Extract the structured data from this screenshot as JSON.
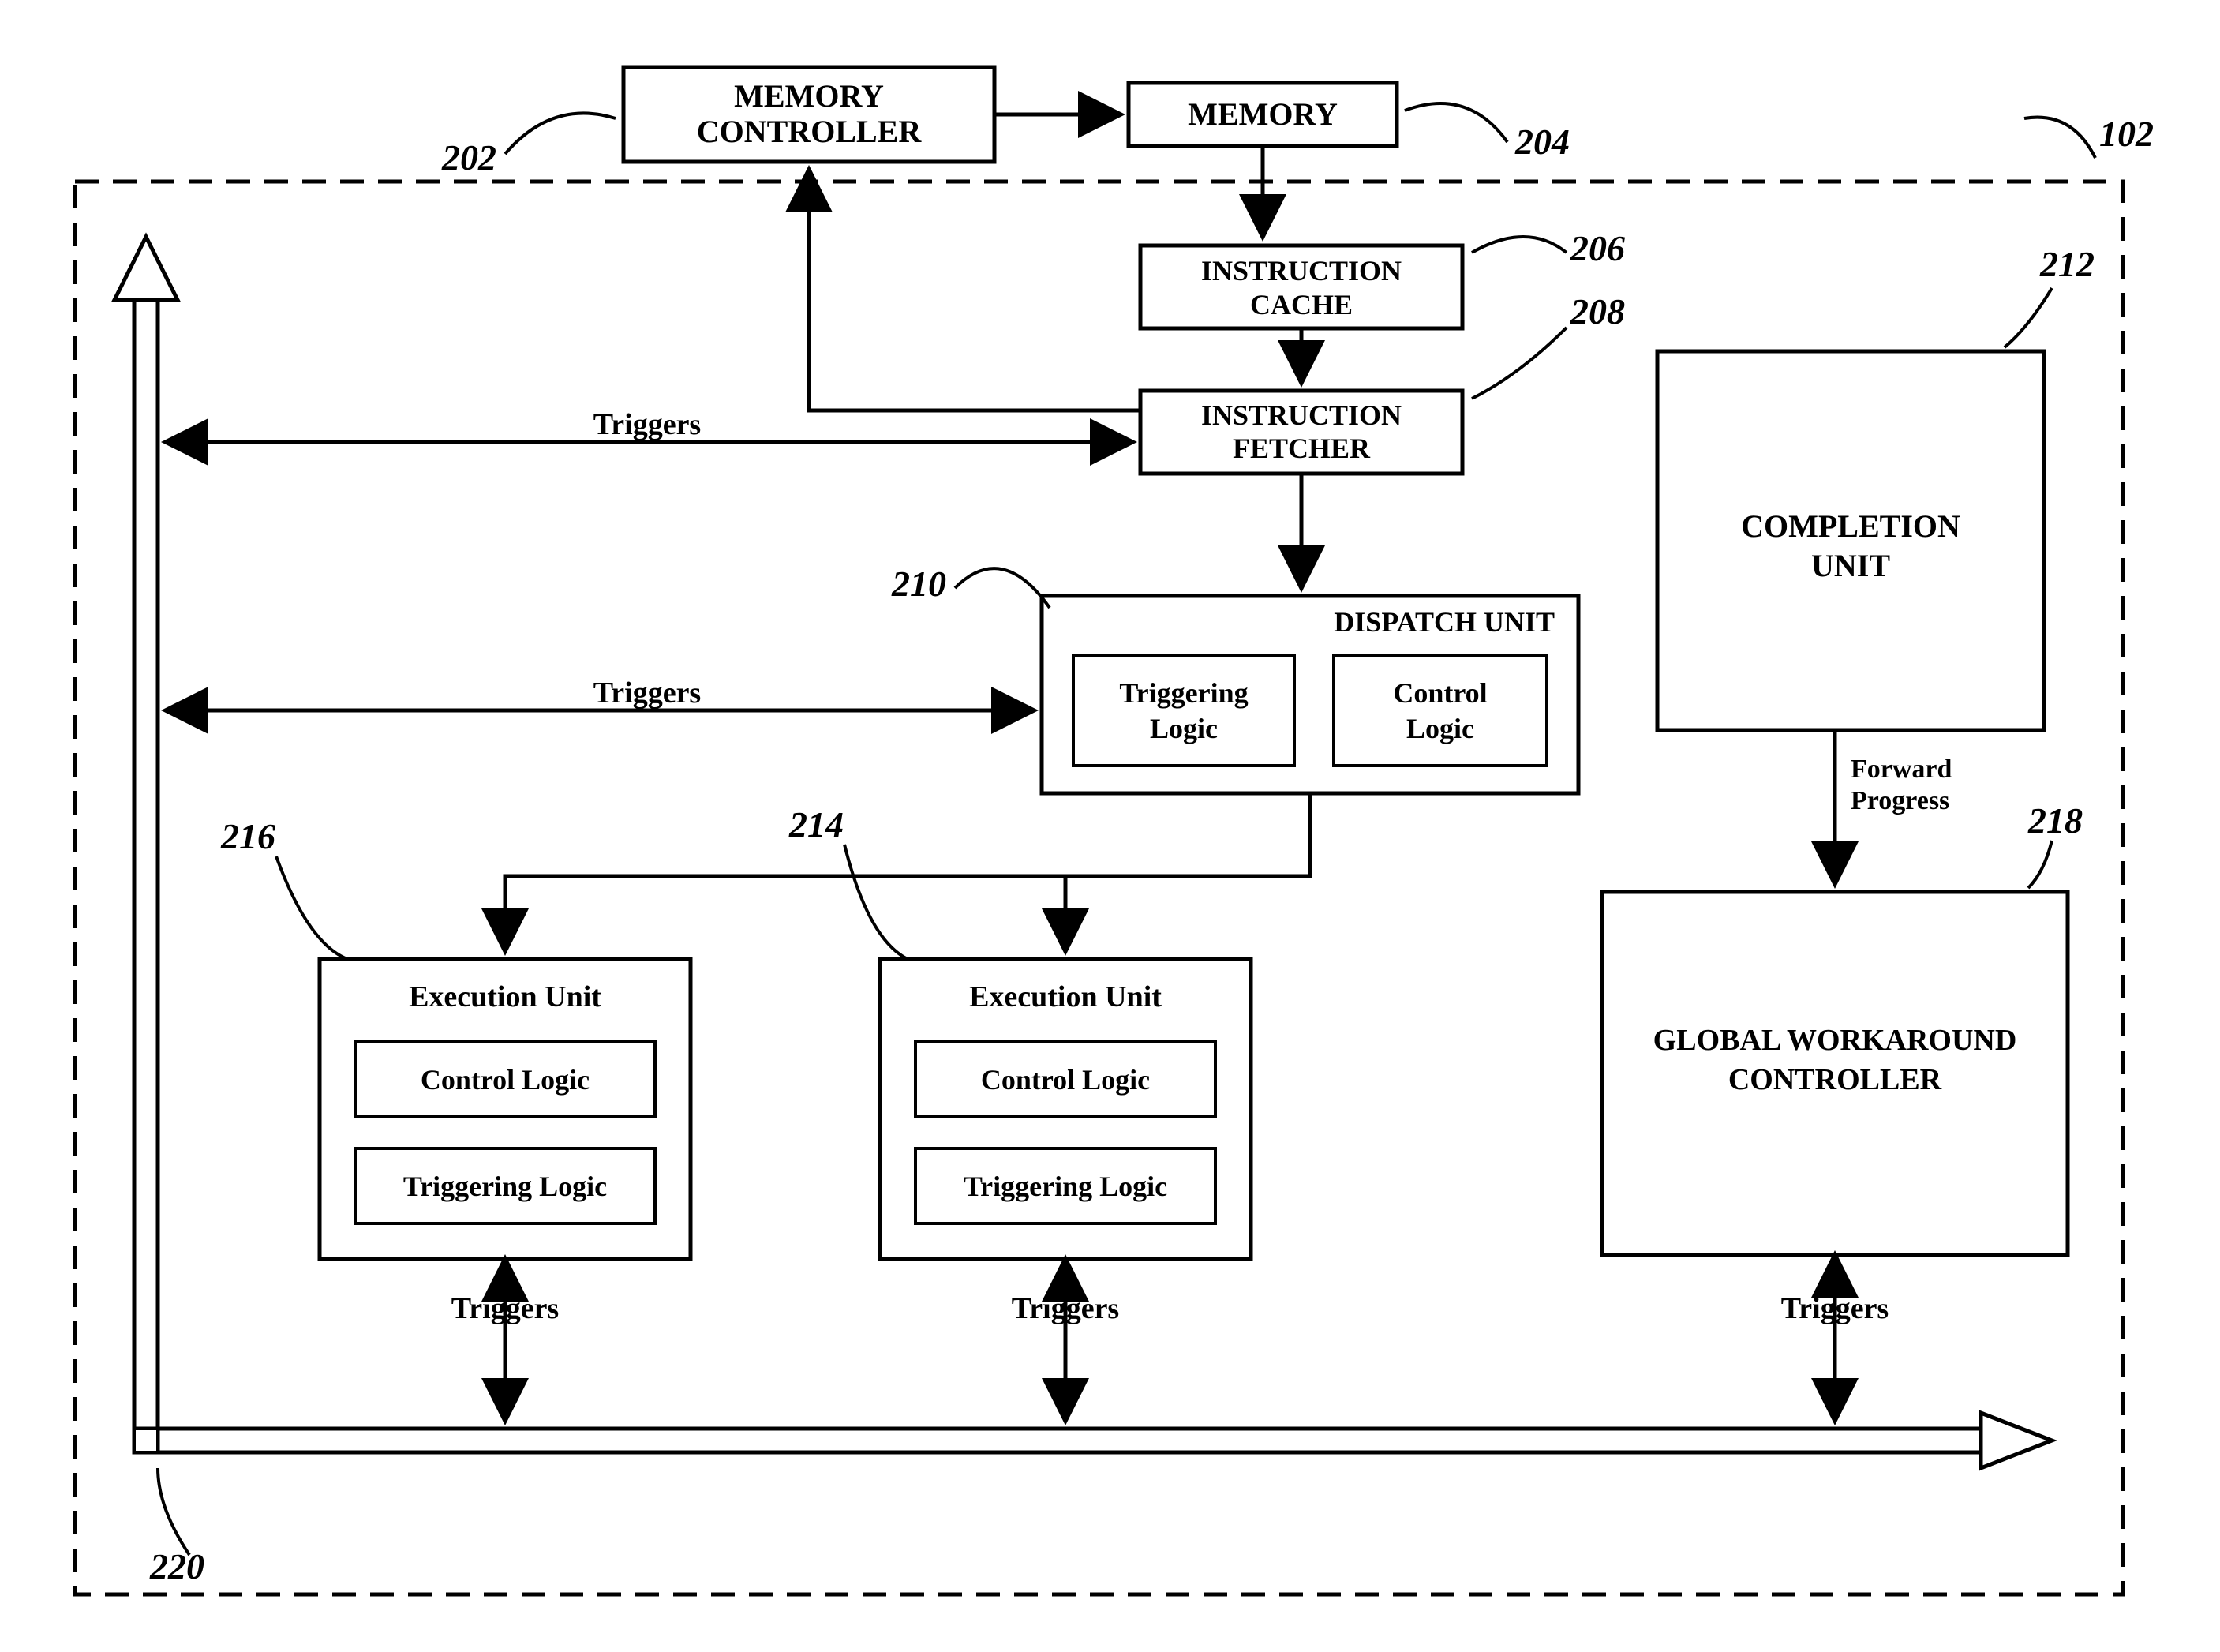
{
  "dashed_boundary_ref": "102",
  "bus_ref": "220",
  "blocks": {
    "memctrl": {
      "label": "MEMORY CONTROLLER",
      "ref": "202"
    },
    "memory": {
      "label": "MEMORY",
      "ref": "204"
    },
    "icache": {
      "label": "INSTRUCTION CACHE",
      "ref": "206"
    },
    "ifetch": {
      "label": "INSTRUCTION FETCHER",
      "ref": "208"
    },
    "dispatch": {
      "label": "DISPATCH UNIT",
      "ref": "210",
      "sub_a": "Triggering Logic",
      "sub_b": "Control Logic"
    },
    "completion": {
      "label": "COMPLETION UNIT",
      "ref": "212"
    },
    "exec214": {
      "label": "Execution Unit",
      "ref": "214",
      "sub_a": "Control Logic",
      "sub_b": "Triggering Logic"
    },
    "exec216": {
      "label": "Execution Unit",
      "ref": "216",
      "sub_a": "Control Logic",
      "sub_b": "Triggering Logic"
    },
    "gwc": {
      "label": "GLOBAL WORKAROUND CONTROLLER",
      "ref": "218"
    }
  },
  "edge_labels": {
    "triggers": "Triggers",
    "forward_progress": "Forward Progress"
  }
}
